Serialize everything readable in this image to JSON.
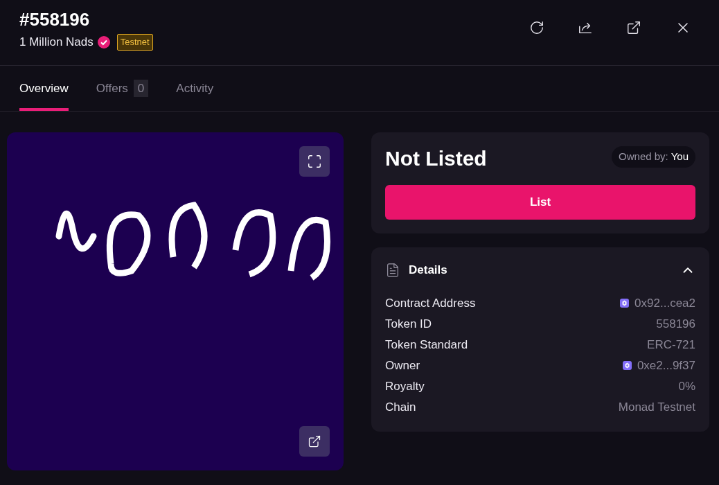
{
  "header": {
    "title": "#558196",
    "collection": "1 Million Nads",
    "verified": true,
    "network_badge": "Testnet"
  },
  "tabs": [
    {
      "label": "Overview",
      "selected": true
    },
    {
      "label": "Offers",
      "count": "0",
      "selected": false
    },
    {
      "label": "Activity",
      "selected": false
    }
  ],
  "listing": {
    "status": "Not Listed",
    "owner_label": "Owned by:",
    "owner": "You",
    "button": "List"
  },
  "details": {
    "title": "Details",
    "expanded": true,
    "rows": [
      {
        "label": "Contract Address",
        "value": "0x92...cea2",
        "kind": "address"
      },
      {
        "label": "Token ID",
        "value": "558196",
        "kind": "plain"
      },
      {
        "label": "Token Standard",
        "value": "ERC-721",
        "kind": "plain"
      },
      {
        "label": "Owner",
        "value": "0xe2...9f37",
        "kind": "address"
      },
      {
        "label": "Royalty",
        "value": "0%",
        "kind": "plain"
      },
      {
        "label": "Chain",
        "value": "Monad Testnet",
        "kind": "plain"
      }
    ]
  }
}
